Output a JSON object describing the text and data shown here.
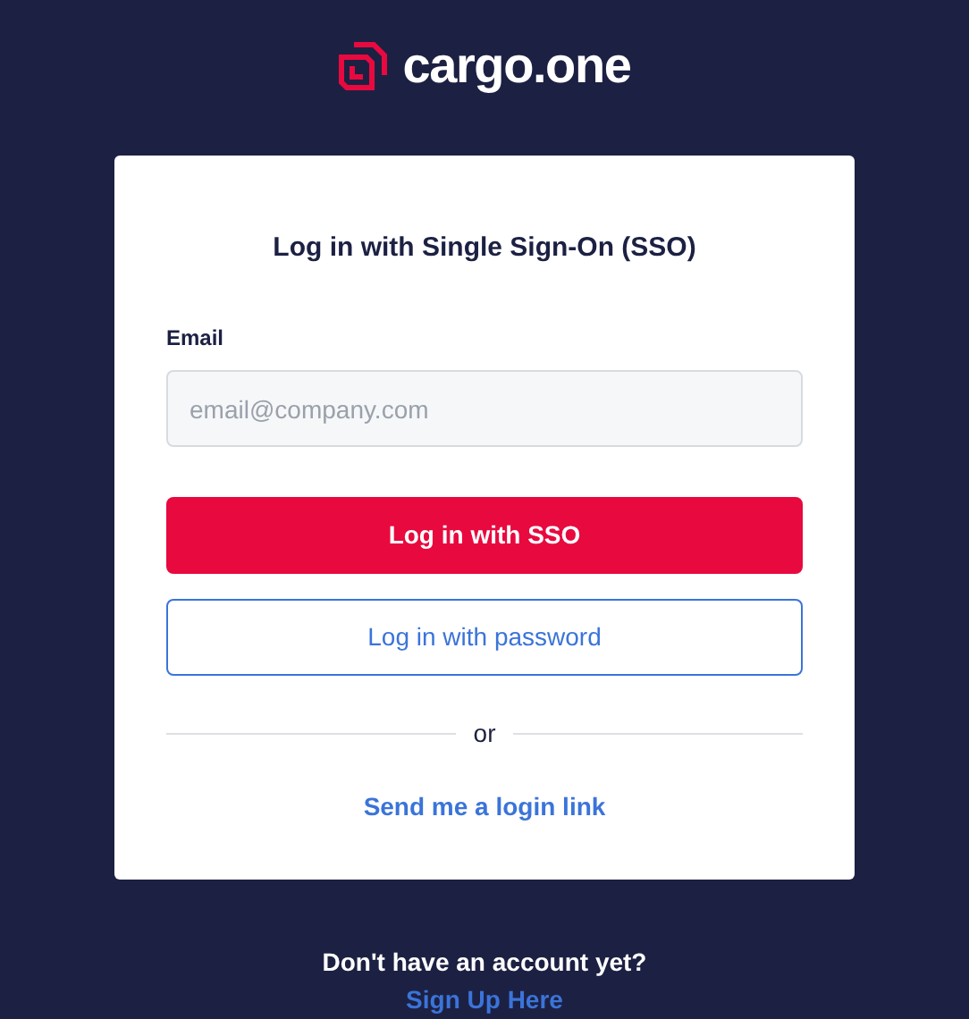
{
  "logo": {
    "text": "cargo.one"
  },
  "card": {
    "title": "Log in with Single Sign-On (SSO)",
    "email": {
      "label": "Email",
      "placeholder": "email@company.com"
    },
    "buttons": [
      {
        "kind": "primary",
        "label": "Log in with SSO"
      },
      {
        "kind": "outline",
        "label": "Log in with password"
      }
    ],
    "divider": "or",
    "link": "Send me a login link"
  },
  "footer": {
    "prompt": "Don't have an account yet?",
    "link": "Sign Up Here"
  }
}
